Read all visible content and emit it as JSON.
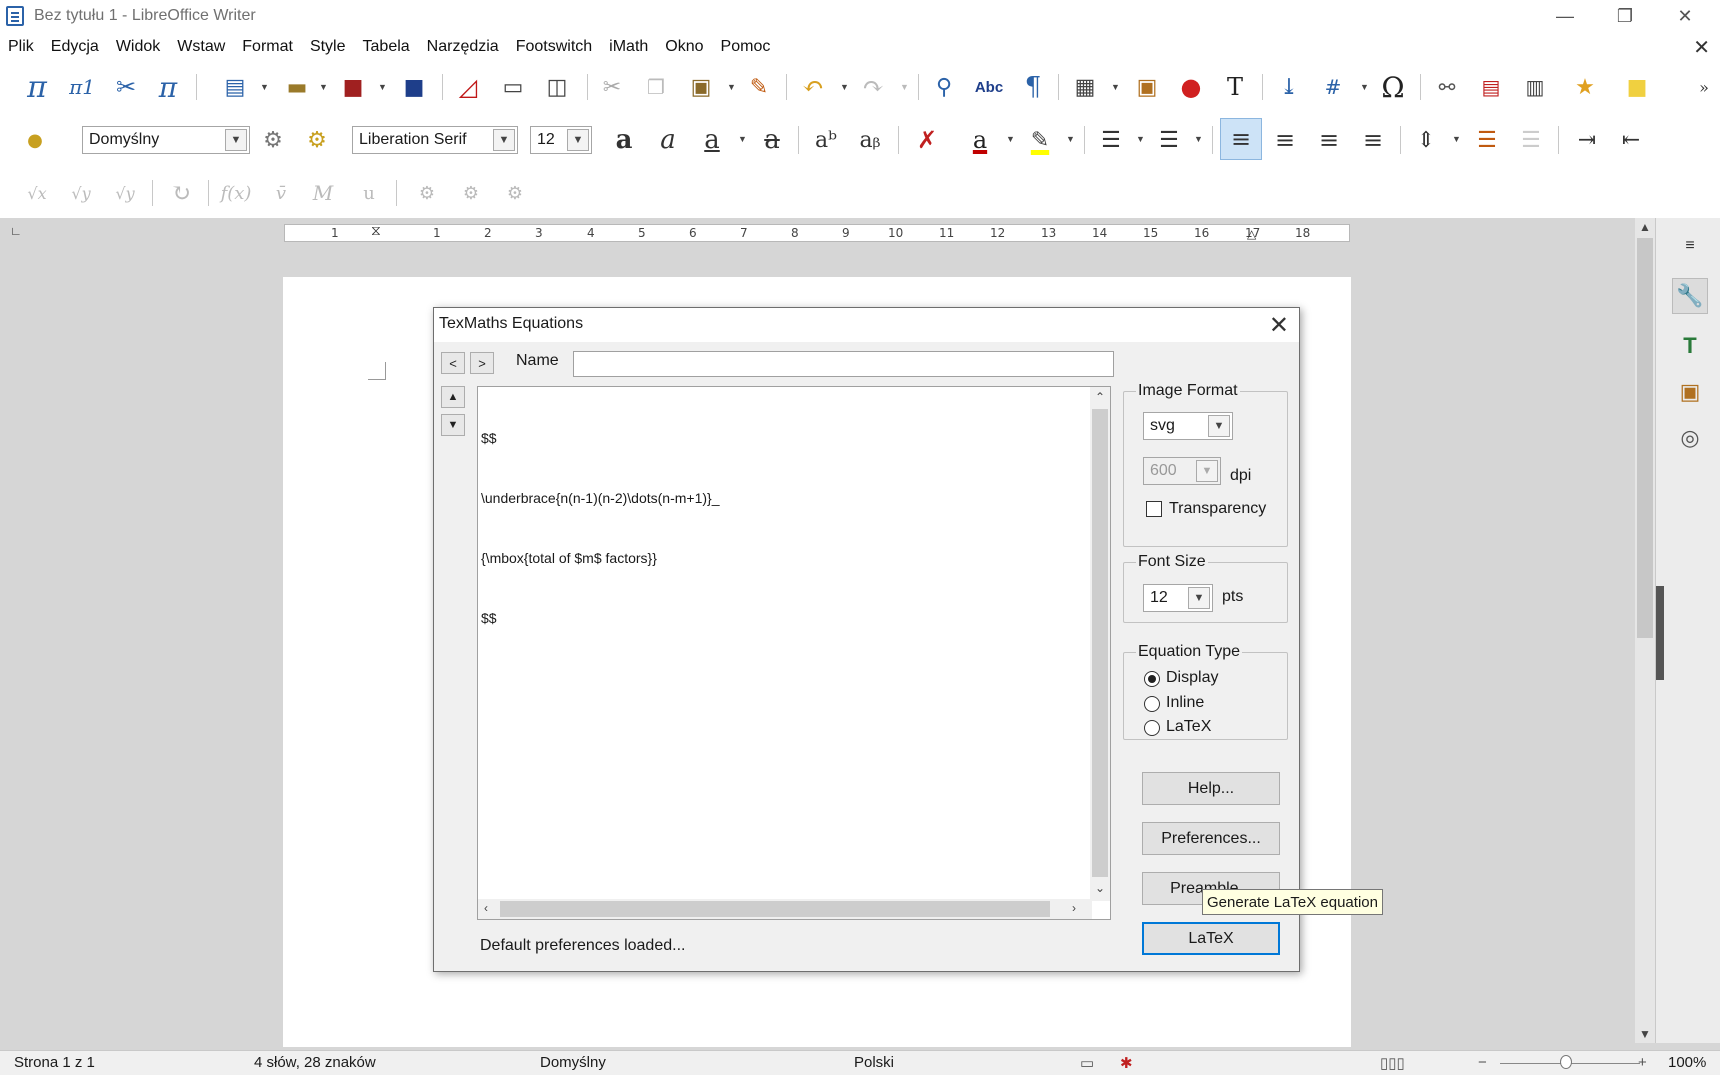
{
  "window": {
    "title": "Bez tytułu 1 - LibreOffice Writer",
    "minimize": "—",
    "restore": "❐",
    "close": "✕"
  },
  "menu": [
    "Plik",
    "Edycja",
    "Widok",
    "Wstaw",
    "Format",
    "Style",
    "Tabela",
    "Narzędzia",
    "Footswitch",
    "iMath",
    "Okno",
    "Pomoc"
  ],
  "menu_close": "✕",
  "formatting": {
    "paragraph_style": "Domyślny",
    "font_name": "Liberation Serif",
    "font_size": "12"
  },
  "ruler": {
    "ticks": [
      "1",
      "1",
      "2",
      "3",
      "4",
      "5",
      "6",
      "7",
      "8",
      "9",
      "10",
      "11",
      "12",
      "13",
      "14",
      "15",
      "16",
      "17",
      "18"
    ]
  },
  "dialog": {
    "title": "TexMaths Equations",
    "close": "✕",
    "prev": "<",
    "next": ">",
    "up": "▲",
    "down": "▼",
    "name_label": "Name",
    "name_value": "",
    "editor_lines": [
      "$$",
      "\\underbrace{n(n-1)(n-2)\\dots(n-m+1)}_",
      "{\\mbox{total of $m$ factors}}",
      "$$"
    ],
    "status": "Default preferences loaded...",
    "image_format": {
      "legend": "Image Format",
      "format": "svg",
      "dpi_value": "600",
      "dpi_label": "dpi",
      "transparency_label": "Transparency",
      "transparency_checked": false
    },
    "font_size": {
      "legend": "Font Size",
      "value": "12",
      "unit": "pts"
    },
    "equation_type": {
      "legend": "Equation Type",
      "options": [
        "Display",
        "Inline",
        "LaTeX"
      ],
      "selected": "Display"
    },
    "buttons": {
      "help": "Help...",
      "preferences": "Preferences...",
      "preamble": "Preamble...",
      "latex": "LaTeX"
    }
  },
  "tooltip": "Generate LaTeX equation",
  "statusbar": {
    "page": "Strona 1 z 1",
    "words": "4 słów, 28 znaków",
    "style": "Domyślny",
    "language": "Polski",
    "zoom": "100%"
  },
  "colors": {
    "accent": "#0078d7",
    "font_color": "#c00000",
    "highlight": "#ffff00",
    "tooltip_bg": "#ffffe1"
  }
}
